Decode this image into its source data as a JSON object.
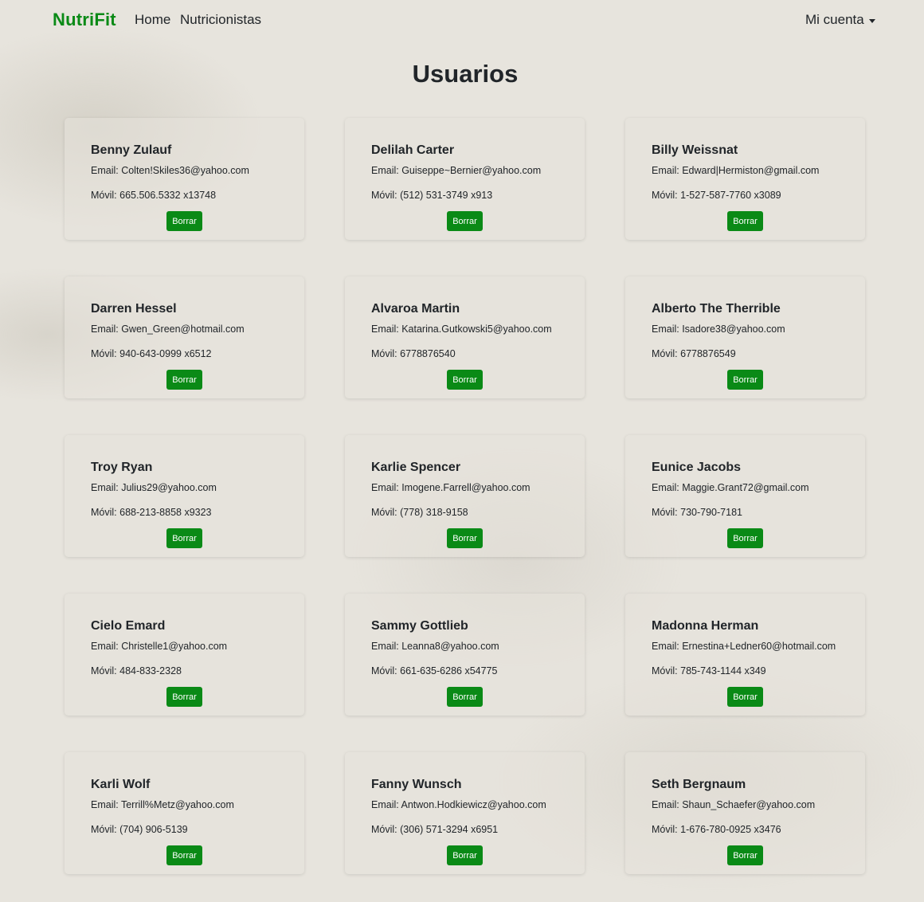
{
  "nav": {
    "brand": "NutriFit",
    "home": "Home",
    "nutritionists": "Nutricionistas",
    "account": "Mi cuenta"
  },
  "page": {
    "title": "Usuarios"
  },
  "colors": {
    "accent": "#0a8a16"
  },
  "labels": {
    "email": "Email: ",
    "mobile": "Móvil: ",
    "delete": "Borrar"
  },
  "users": [
    {
      "name": "Benny Zulauf",
      "email": "Colten!Skiles36@yahoo.com",
      "mobile": "665.506.5332 x13748"
    },
    {
      "name": "Delilah Carter",
      "email": "Guiseppe~Bernier@yahoo.com",
      "mobile": "(512) 531-3749 x913"
    },
    {
      "name": "Billy Weissnat",
      "email": "Edward|Hermiston@gmail.com",
      "mobile": "1-527-587-7760 x3089"
    },
    {
      "name": "Darren Hessel",
      "email": "Gwen_Green@hotmail.com",
      "mobile": "940-643-0999 x6512"
    },
    {
      "name": "Alvaroa Martin",
      "email": "Katarina.Gutkowski5@yahoo.com",
      "mobile": "6778876540"
    },
    {
      "name": "Alberto The Therrible",
      "email": "Isadore38@yahoo.com",
      "mobile": "6778876549"
    },
    {
      "name": "Troy Ryan",
      "email": "Julius29@yahoo.com",
      "mobile": "688-213-8858 x9323"
    },
    {
      "name": "Karlie Spencer",
      "email": "Imogene.Farrell@yahoo.com",
      "mobile": "(778) 318-9158"
    },
    {
      "name": "Eunice Jacobs",
      "email": "Maggie.Grant72@gmail.com",
      "mobile": "730-790-7181"
    },
    {
      "name": "Cielo Emard",
      "email": "Christelle1@yahoo.com",
      "mobile": "484-833-2328"
    },
    {
      "name": "Sammy Gottlieb",
      "email": "Leanna8@yahoo.com",
      "mobile": "661-635-6286 x54775"
    },
    {
      "name": "Madonna Herman",
      "email": "Ernestina+Ledner60@hotmail.com",
      "mobile": "785-743-1144 x349"
    },
    {
      "name": "Karli Wolf",
      "email": "Terrill%Metz@yahoo.com",
      "mobile": "(704) 906-5139"
    },
    {
      "name": "Fanny Wunsch",
      "email": "Antwon.Hodkiewicz@yahoo.com",
      "mobile": "(306) 571-3294 x6951"
    },
    {
      "name": "Seth Bergnaum",
      "email": "Shaun_Schaefer@yahoo.com",
      "mobile": "1-676-780-0925 x3476"
    }
  ]
}
